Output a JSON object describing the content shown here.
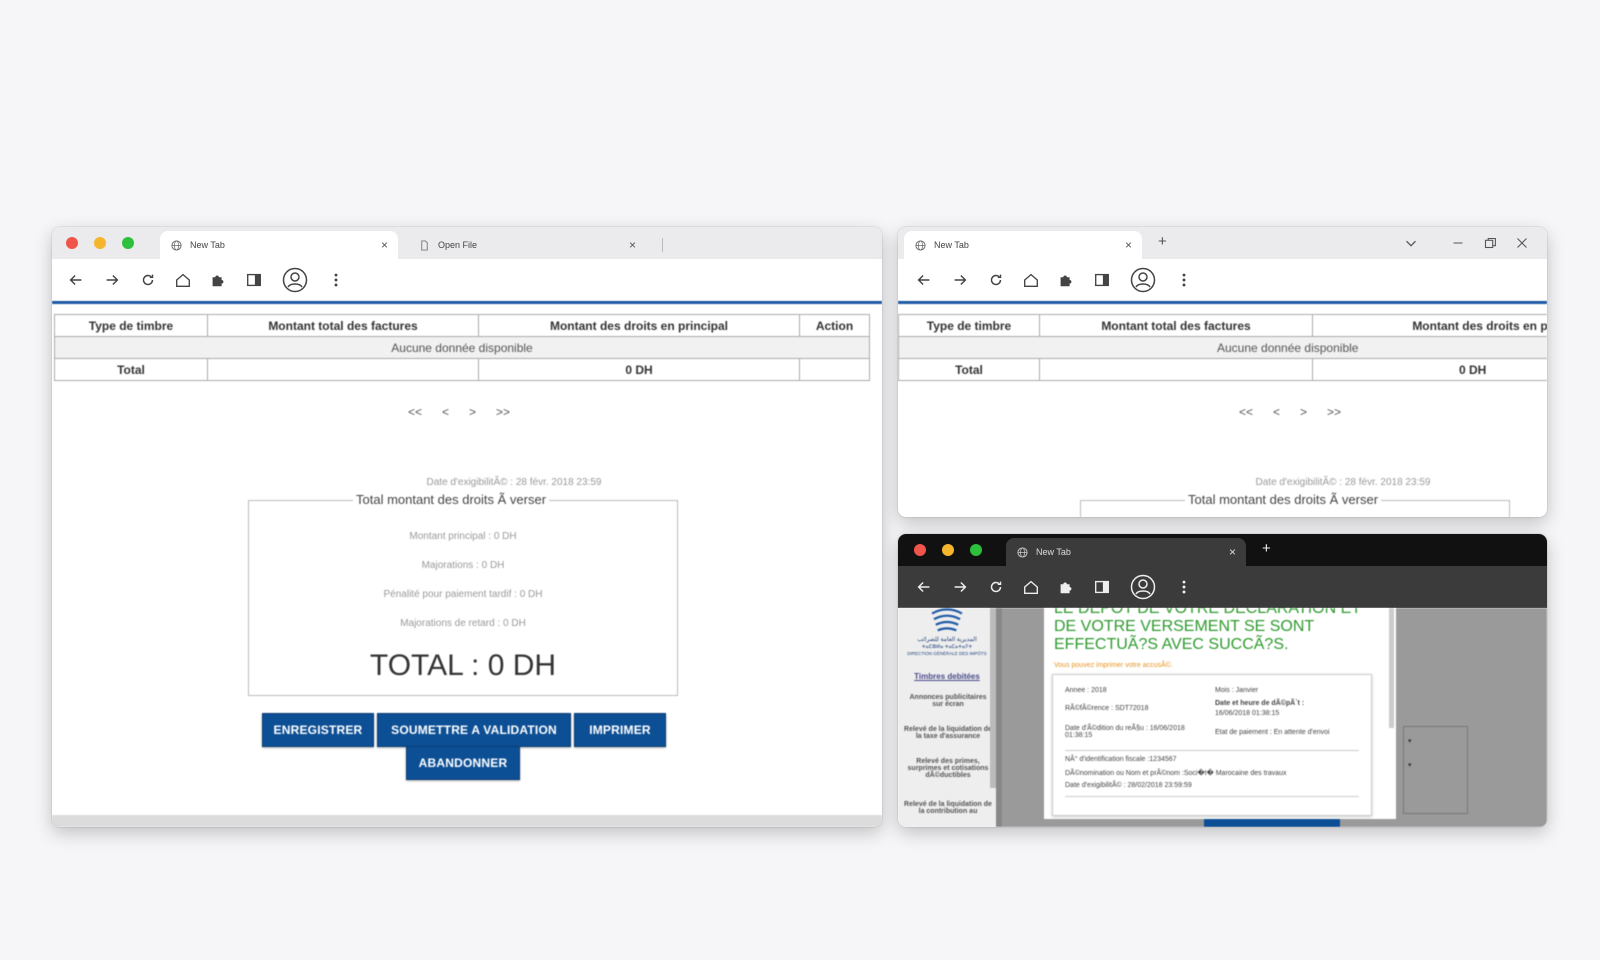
{
  "left_window": {
    "tabs": [
      {
        "label": "New Tab",
        "icon": "globe-icon"
      },
      {
        "label": "Open File",
        "icon": "file-icon"
      }
    ],
    "close_glyph": "×",
    "table": {
      "headers": [
        "Type de timbre",
        "Montant total des factures",
        "Montant des droits en principal",
        "Action"
      ],
      "no_data": "Aucune donnée disponible",
      "total_row": [
        "Total",
        "",
        "0 DH",
        ""
      ]
    },
    "pager": [
      "<<",
      "<",
      ">",
      ">>"
    ],
    "date_exig": "Date d'exigibilitÃ© : 28 févr. 2018 23:59",
    "fieldset_legend": "Total montant des droits Ã  verser",
    "rows": [
      "Montant principal : 0 DH",
      "Majorations : 0 DH",
      "Pénalité pour paiement tardif : 0 DH",
      "Majorations de retard : 0 DH"
    ],
    "total": "TOTAL : 0 DH",
    "buttons": [
      "ENREGISTRER",
      "SOUMETTRE A VALIDATION",
      "IMPRIMER",
      "ABANDONNER"
    ]
  },
  "right_top_window": {
    "tab": "New Tab",
    "close_glyph": "×",
    "plus": "+",
    "table": {
      "headers": [
        "Type de timbre",
        "Montant total des factures",
        "Montant des droits en princi"
      ],
      "no_data": "Aucune donnée disponible",
      "total_row": [
        "Total",
        "",
        "0 DH"
      ]
    },
    "pager": [
      "<<",
      "<",
      ">",
      ">>"
    ],
    "date_exig": "Date d'exigibilitÃ© : 28 févr. 2018 23:59",
    "fieldset_legend": "Total montant des droits Ã  verser"
  },
  "right_bottom_window": {
    "tab": "New Tab",
    "close_glyph": "×",
    "plus": "+",
    "sidebar": {
      "logo_arabic": "المديرية العامة للضرائب",
      "logo_tifinagh": "ⵜⴰⵎⵀⵍⴰ ⵜⴰⵎⴰⵜⴰⵢⵜ",
      "logo_fr": "DIRECTION GÉNÉRALE DES IMPÔTS",
      "title": "Timbres debitées",
      "items": [
        "Annonces publicitaires sur écran",
        "Relevé de la liquidation de la taxe d'assurance",
        "Relevé des primes, surprimes et cotisations dÃ©ductibles",
        "Relevé de la liquidation de la contribution au"
      ]
    },
    "message": "LE DEPOT DE VOTRE DECLARATION ET DE VOTRE VERSEMENT SE SONT EFFECTUÃ?S AVEC SUCCÃ?S.",
    "print_hint": "Vous pouvez imprimer votre accusÃ©.",
    "receipt": {
      "annee": "Annee : 2018",
      "mois": "Mois : Janvier",
      "reference": "RÃ©fÃ©rence : SDT72018",
      "date_depot_label": "Date et heure de dÃ©pÃ´t :",
      "date_depot_value": "16/06/2018 01:38:15",
      "date_edition": "Date d'Ã©dition du reÃ§u : 16/06/2018 01:38:15",
      "etat": "Etat de paiement : En attente d'envoi",
      "identifiant": "NÂ° d'identification fiscale :1234567",
      "denomination": "DÃ©nomination ou Nom et prÃ©nom :Soci�t� Marocaine des travaux",
      "exigibilite": "Date d'exigibilitÃ© : 28/02/2018 23:59:59"
    }
  },
  "colors": {
    "primary_button": "#0d4f95",
    "header_bar": "#1f5aa6",
    "success_text": "#2e9a2e",
    "hint_text": "#e6921f"
  }
}
